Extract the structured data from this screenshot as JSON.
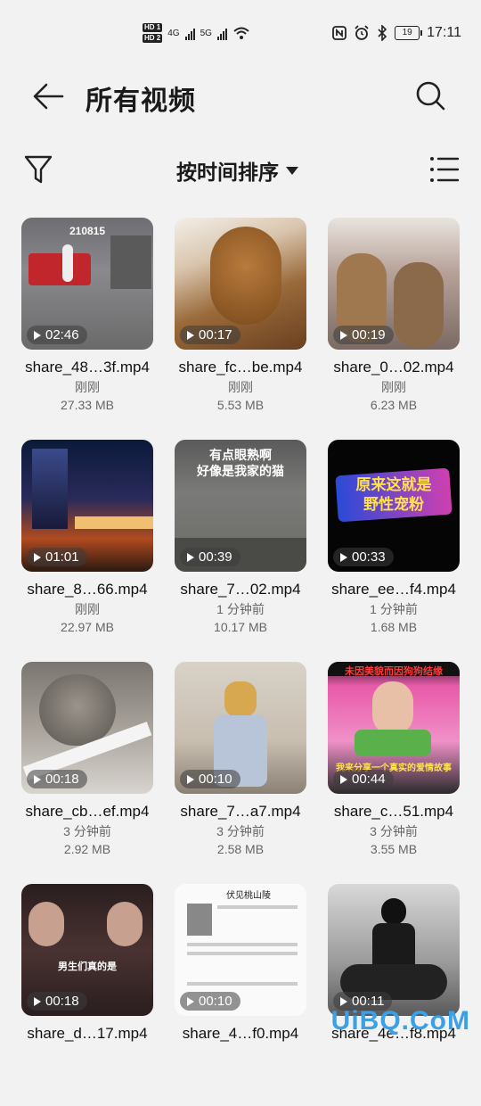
{
  "status": {
    "hd1": "HD 1",
    "hd2": "HD 2",
    "net1": "4G",
    "net2": "5G",
    "battery": "19",
    "time": "17:11"
  },
  "header": {
    "title": "所有视频"
  },
  "toolbar": {
    "sort_label": "按时间排序"
  },
  "videos": [
    {
      "name": "share_48…3f.mp4",
      "time": "刚刚",
      "size": "27.33 MB",
      "duration": "02:46",
      "thumb_text": "210815"
    },
    {
      "name": "share_fc…be.mp4",
      "time": "刚刚",
      "size": "5.53 MB",
      "duration": "00:17"
    },
    {
      "name": "share_0…02.mp4",
      "time": "刚刚",
      "size": "6.23 MB",
      "duration": "00:19"
    },
    {
      "name": "share_8…66.mp4",
      "time": "刚刚",
      "size": "22.97 MB",
      "duration": "01:01"
    },
    {
      "name": "share_7…02.mp4",
      "time": "1 分钟前",
      "size": "10.17 MB",
      "duration": "00:39",
      "thumb_text": "有点眼熟啊\n好像是我家的猫"
    },
    {
      "name": "share_ee…f4.mp4",
      "time": "1 分钟前",
      "size": "1.68 MB",
      "duration": "00:33",
      "thumb_text": "原来这就是\n野性宠粉"
    },
    {
      "name": "share_cb…ef.mp4",
      "time": "3 分钟前",
      "size": "2.92 MB",
      "duration": "00:18"
    },
    {
      "name": "share_7…a7.mp4",
      "time": "3 分钟前",
      "size": "2.58 MB",
      "duration": "00:10"
    },
    {
      "name": "share_c…51.mp4",
      "time": "3 分钟前",
      "size": "3.55 MB",
      "duration": "00:44",
      "thumb_text": "未因美貌而因狗狗结缘",
      "thumb_text2": "我来分享一个真实的爱情故事"
    },
    {
      "name": "share_d…17.mp4",
      "time": "",
      "size": "",
      "duration": "00:18",
      "thumb_text": "男生们真的是"
    },
    {
      "name": "share_4…f0.mp4",
      "time": "",
      "size": "",
      "duration": "00:10",
      "thumb_text": "伏见桃山陵"
    },
    {
      "name": "share_4e…f8.mp4",
      "time": "",
      "size": "",
      "duration": "00:11"
    }
  ],
  "watermark": "UiBQ.CoM",
  "colors": {
    "background": "#f2f2f2",
    "text": "#1a1a1a",
    "secondary": "#666666"
  }
}
